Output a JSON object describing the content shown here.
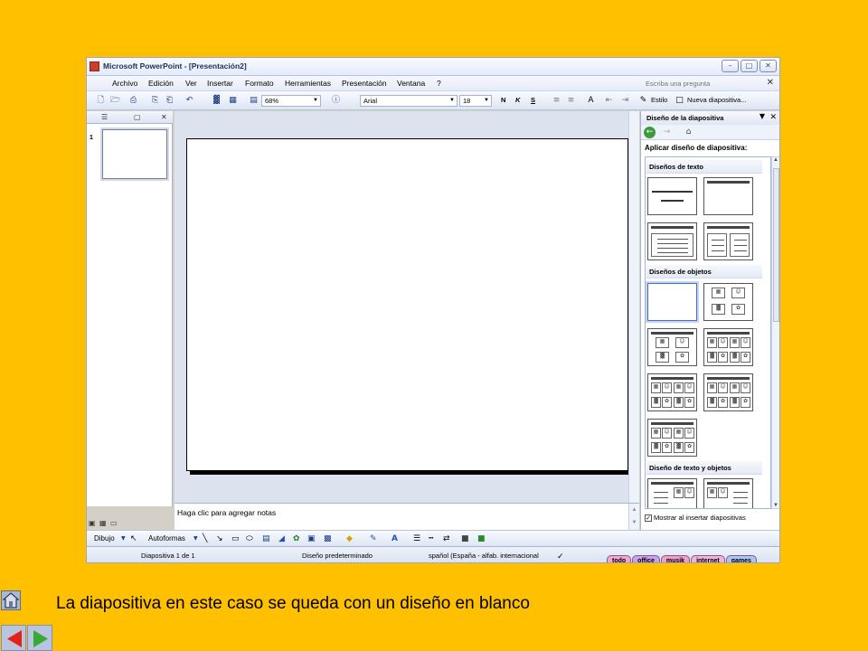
{
  "window": {
    "title": "Microsoft PowerPoint - [Presentación2]"
  },
  "menu": {
    "items": [
      "Archivo",
      "Edición",
      "Ver",
      "Insertar",
      "Formato",
      "Herramientas",
      "Presentación",
      "Ventana",
      "?"
    ],
    "help_placeholder": "Escriba una pregunta"
  },
  "toolbar": {
    "zoom": "68%",
    "font": "Arial",
    "font_size": "18",
    "bold": "N",
    "italic": "K",
    "underline": "S",
    "style_label": "Estilo",
    "new_slide_label": "Nueva diapositiva..."
  },
  "outline": {
    "slide_number": "1"
  },
  "notes": {
    "placeholder": "Haga clic para agregar notas"
  },
  "task_pane": {
    "title": "Diseño de la diapositiva",
    "apply_label": "Aplicar diseño de diapositiva:",
    "sections": {
      "text": "Diseños de texto",
      "objects": "Diseños de objetos",
      "text_objects": "Diseño de texto y objetos"
    },
    "show_on_insert": "Mostrar al insertar diapositivas"
  },
  "drawing": {
    "draw_label": "Dibujo",
    "autoshapes_label": "Autoformas"
  },
  "status": {
    "slide": "Diapositiva 1 de 1",
    "design": "Diseño predeterminado",
    "language": "spañol (España - alfab. internacional"
  },
  "taskbar_tabs": [
    {
      "label": "todo",
      "color": "#F4A7C9"
    },
    {
      "label": "office",
      "color": "#C9A2E8"
    },
    {
      "label": "musik",
      "color": "#F0A0C0"
    },
    {
      "label": "internet",
      "color": "#F2B4D0"
    },
    {
      "label": "games",
      "color": "#A7C6F0"
    }
  ],
  "caption": "La diapositiva en este caso se queda con un diseño en blanco",
  "icons": [
    "home-icon",
    "prev-arrow-icon",
    "next-arrow-icon"
  ],
  "colors": {
    "background": "#FFC000",
    "arrow_red": "#E1211A",
    "arrow_green": "#39A935"
  }
}
